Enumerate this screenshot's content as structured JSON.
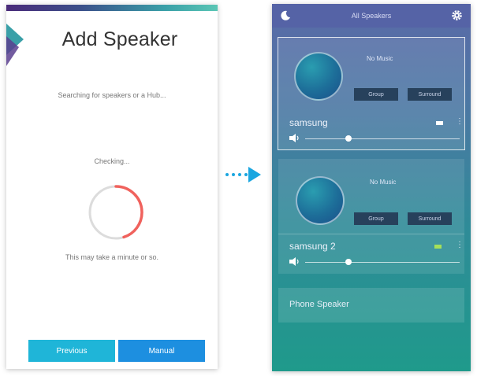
{
  "add_speaker": {
    "title": "Add Speaker",
    "searching_text": "Searching for speakers or a Hub...",
    "checking_text": "Checking...",
    "wait_text": "This may take a minute or so.",
    "previous_label": "Previous",
    "manual_label": "Manual",
    "spinner_progress": 0.45
  },
  "speakers_screen": {
    "header_title": "All Speakers",
    "speakers": [
      {
        "music_label": "No Music",
        "group_label": "Group",
        "surround_label": "Surround",
        "name": "samsung",
        "volume": 0.28
      },
      {
        "music_label": "No Music",
        "group_label": "Group",
        "surround_label": "Surround",
        "name": "samsung 2",
        "volume": 0.28
      }
    ],
    "phone_speaker_label": "Phone Speaker"
  },
  "colors": {
    "accent_blue": "#1fb5d8",
    "manual_blue": "#1d8fe0",
    "spinner_red": "#f0625d",
    "arrow_blue": "#1aa6e0"
  }
}
